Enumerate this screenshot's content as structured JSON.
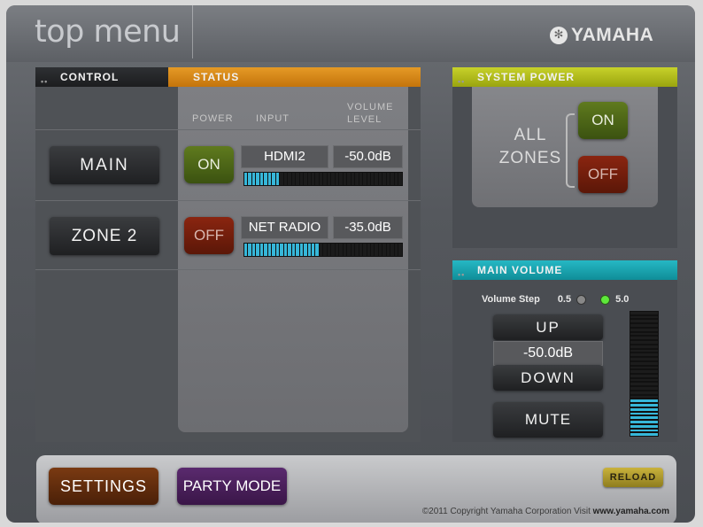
{
  "header": {
    "title": "top menu",
    "brand": "YAMAHA",
    "brand_icon": "tuning-fork-icon"
  },
  "control_panel": {
    "control_label": "CONTROL",
    "status_label": "STATUS",
    "col_power": "POWER",
    "col_input": "INPUT",
    "col_volume": "VOLUME LEVEL"
  },
  "zones": [
    {
      "name": "MAIN",
      "power": "ON",
      "input": "HDMI2",
      "volume": "-50.0dB",
      "level": 0.22
    },
    {
      "name": "ZONE 2",
      "power": "OFF",
      "input": "NET RADIO",
      "volume": "-35.0dB",
      "level": 0.47
    }
  ],
  "system_power": {
    "label": "SYSTEM POWER",
    "all_zones_line1": "ALL",
    "all_zones_line2": "ZONES",
    "on": "ON",
    "off": "OFF"
  },
  "main_volume": {
    "label": "MAIN VOLUME",
    "step_label": "Volume Step",
    "step_options": [
      "0.5",
      "5.0"
    ],
    "step_selected": "5.0",
    "up": "UP",
    "value": "-50.0dB",
    "down": "DOWN",
    "mute": "MUTE",
    "level": 0.3
  },
  "footer": {
    "settings": "SETTINGS",
    "party_mode": "PARTY MODE",
    "reload": "RELOAD",
    "copyright": "©2011 Copyright Yamaha Corporation Visit ",
    "site": "www.yamaha.com"
  },
  "colors": {
    "status_bar": "#d98a1a",
    "system_power_bar": "#b6c21a",
    "main_volume_bar": "#1aa8b3",
    "meter_lit": "#37b7d9"
  }
}
